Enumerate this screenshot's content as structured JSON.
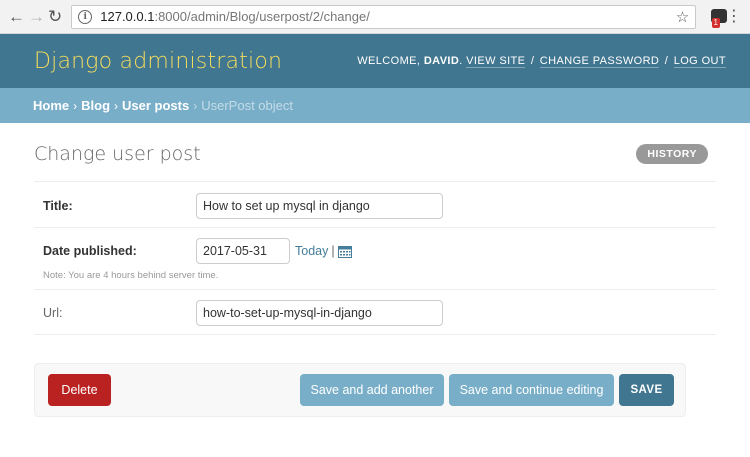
{
  "browser": {
    "url_host": "127.0.0.1",
    "url_path": ":8000/admin/Blog/userpost/2/change/",
    "extension_badge": "1"
  },
  "header": {
    "brand": "Django administration",
    "welcome": "WELCOME,",
    "username": "DAVID",
    "view_site": "VIEW SITE",
    "change_password": "CHANGE PASSWORD",
    "log_out": "LOG OUT"
  },
  "breadcrumbs": {
    "home": "Home",
    "app": "Blog",
    "model": "User posts",
    "current": "UserPost object"
  },
  "page": {
    "title": "Change user post",
    "history": "HISTORY"
  },
  "form": {
    "title_label": "Title:",
    "title_value": "How to set up mysql in django",
    "date_label": "Date published:",
    "date_value": "2017-05-31",
    "today_link": "Today",
    "date_help": "Note: You are 4 hours behind server time.",
    "url_label": "Url:",
    "url_value": "how-to-set-up-mysql-in-django"
  },
  "submit": {
    "delete": "Delete",
    "save_add_another": "Save and add another",
    "save_continue": "Save and continue editing",
    "save": "SAVE"
  },
  "colors": {
    "header_bg": "#417690",
    "brand": "#f5dd5d",
    "breadcrumbs_bg": "#79aec8",
    "delete_bg": "#ba2121",
    "secondary_btn": "#79aec8",
    "primary_btn": "#417690"
  }
}
